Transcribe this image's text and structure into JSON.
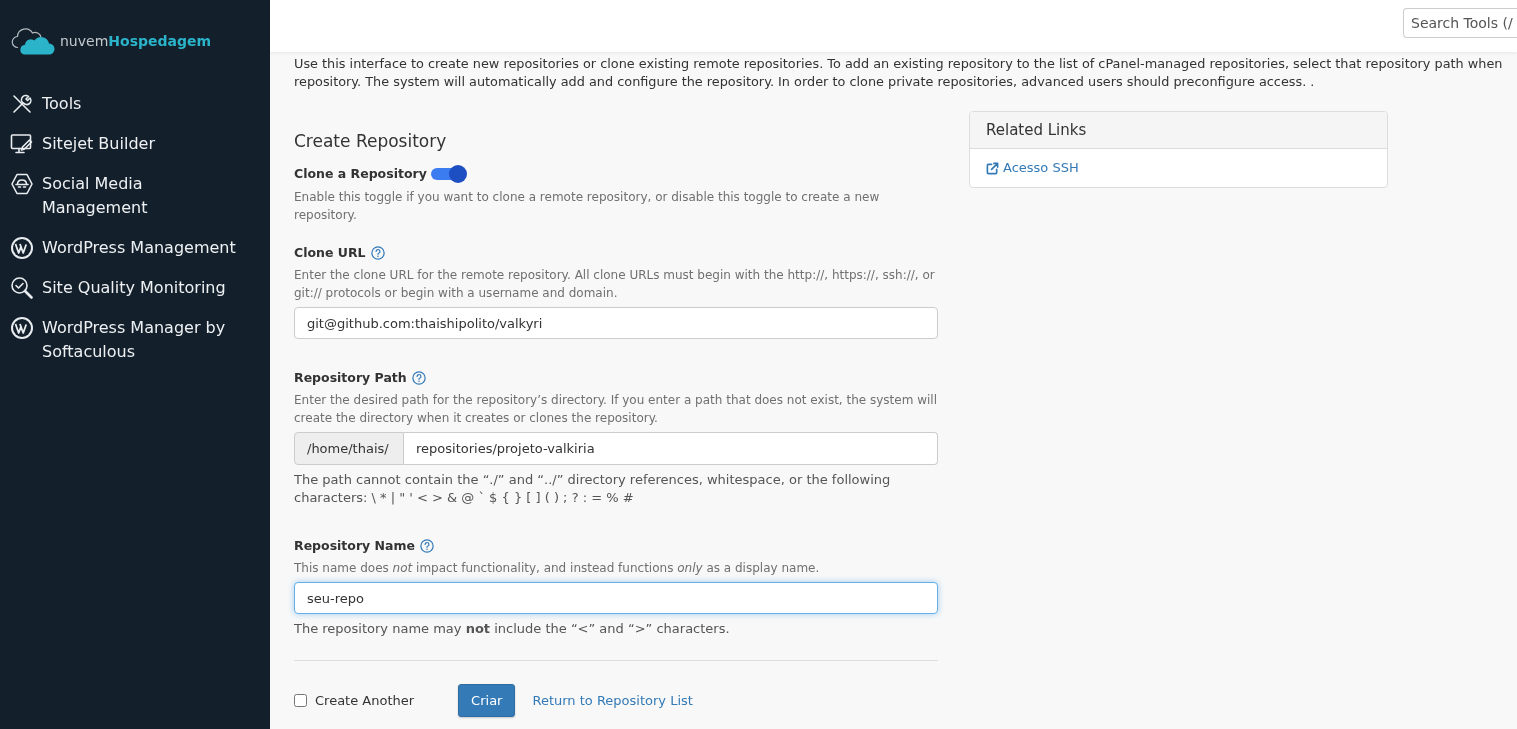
{
  "sidebar": {
    "logo": "nuvem**Hospedagem**",
    "items": [
      {
        "label": "Tools",
        "kind": "tools"
      },
      {
        "label": "Sitejet Builder",
        "kind": "builder"
      },
      {
        "label": "Social Media Management",
        "kind": "social"
      },
      {
        "label": "WordPress Management",
        "kind": "wordpress"
      },
      {
        "label": "Site Quality Monitoring",
        "kind": "monitoring"
      },
      {
        "label": "WordPress Manager by Softaculous",
        "kind": "wordpress"
      }
    ]
  },
  "header": {
    "search": {
      "placeholder": "Search Tools (/"
    }
  },
  "intro": "Use this interface to create new repositories or clone existing remote repositories. To add an existing repository to the list of cPanel-managed repositories, select that repository path when\nrepository. The system will automatically add and configure the repository. In order to clone private repositories, advanced users should preconfigure access. .",
  "form": {
    "title": "Create Repository",
    "clone_toggle": {
      "label": "Clone a Repository",
      "on": true,
      "help": "Enable this toggle if you want to clone a remote repository, or disable this toggle to create a new repository."
    },
    "fields": [
      {
        "kind": "input",
        "label": "Clone URL",
        "help": "Enter the clone URL for the remote repository. All clone URLs must begin with the http://, https://, ssh://, or git:// protocols or begin with a username and domain.",
        "value": "git@github.com:thaishipolito/valkyri",
        "focused": false
      },
      {
        "kind": "prefixed",
        "label": "Repository Path",
        "help": "Enter the desired path for the repository’s directory. If you enter a path that does not exist, the system will create the directory when it creates or clones the repository.",
        "prefix": "/home/thais/",
        "value": "repositories/projeto-valkiria",
        "focused": false,
        "note": "The path cannot contain the “./” and “../” directory references, whitespace, or the following characters: \\ * | \" ' < > & @ ` $ { } [ ] ( ) ; ? : = % #"
      },
      {
        "kind": "input",
        "label": "Repository Name",
        "help": "This name does *not* impact functionality, and instead functions *only* as a display name.",
        "value": "seu-repo",
        "focused": true,
        "note": "The repository name may **not** include the “<” and “>” characters."
      }
    ],
    "create_another": {
      "label": "Create Another",
      "checked": false
    },
    "submit": "Criar",
    "return_link": "Return to Repository List"
  },
  "related_links": {
    "title": "Related Links",
    "links": [
      "Acesso SSH"
    ]
  }
}
